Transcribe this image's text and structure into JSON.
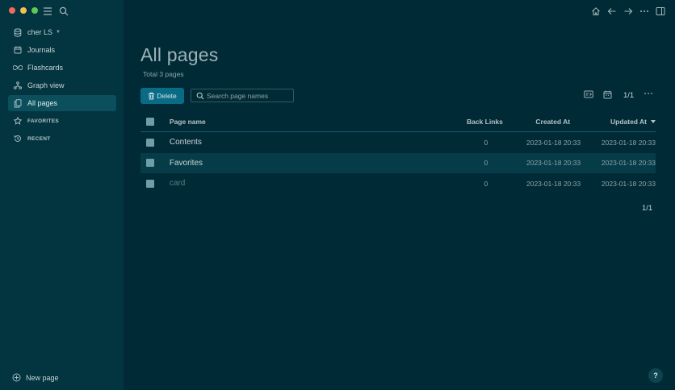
{
  "sidebar": {
    "graph_name": "cher LS",
    "items": [
      {
        "label": "Journals",
        "icon": "calendar-icon"
      },
      {
        "label": "Flashcards",
        "icon": "infinity-icon"
      },
      {
        "label": "Graph view",
        "icon": "hierarchy-icon"
      },
      {
        "label": "All pages",
        "icon": "files-icon"
      }
    ],
    "favorites_label": "FAVORITES",
    "recent_label": "RECENT",
    "new_page_label": "New page"
  },
  "main": {
    "title": "All pages",
    "total": "Total 3 pages",
    "delete_label": "Delete",
    "search_placeholder": "Search page names",
    "pager": "1/1",
    "columns": {
      "name": "Page name",
      "back_links": "Back Links",
      "created": "Created At",
      "updated": "Updated At"
    },
    "rows": [
      {
        "name": "Contents",
        "back_links": "0",
        "created": "2023-01-18 20:33",
        "updated": "2023-01-18 20:33"
      },
      {
        "name": "Favorites",
        "back_links": "0",
        "created": "2023-01-18 20:33",
        "updated": "2023-01-18 20:33"
      },
      {
        "name": "card",
        "back_links": "0",
        "created": "2023-01-18 20:33",
        "updated": "2023-01-18 20:33"
      }
    ],
    "pager_bottom": "1/1",
    "help_label": "?"
  },
  "colors": {
    "background": "#002b36",
    "sidebar": "#033540",
    "accent": "#0a6b87"
  }
}
